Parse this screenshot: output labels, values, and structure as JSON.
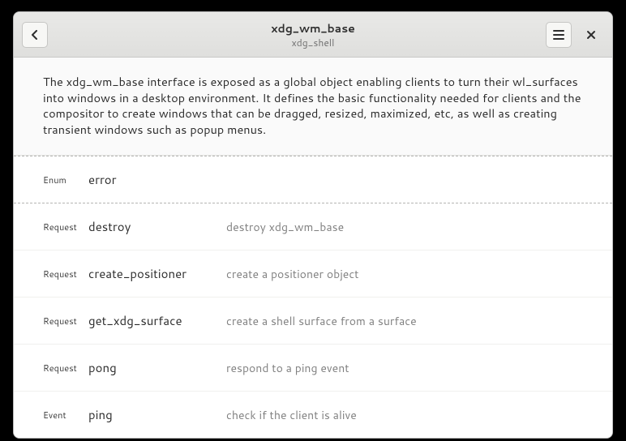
{
  "header": {
    "title": "xdg_wm_base",
    "subtitle": "xdg_shell"
  },
  "description": "The xdg_wm_base interface is exposed as a global object enabling clients to turn their wl_surfaces into windows in a desktop environment. It defines the basic functionality needed for clients and the compositor to create windows that can be dragged, resized, maximized, etc, as well as creating transient windows such as popup menus.",
  "rows": [
    {
      "kind": "Enum",
      "name": "error",
      "summary": ""
    },
    {
      "kind": "Request",
      "name": "destroy",
      "summary": "destroy xdg_wm_base"
    },
    {
      "kind": "Request",
      "name": "create_positioner",
      "summary": "create a positioner object"
    },
    {
      "kind": "Request",
      "name": "get_xdg_surface",
      "summary": "create a shell surface from a surface"
    },
    {
      "kind": "Request",
      "name": "pong",
      "summary": "respond to a ping event"
    },
    {
      "kind": "Event",
      "name": "ping",
      "summary": "check if the client is alive"
    }
  ]
}
